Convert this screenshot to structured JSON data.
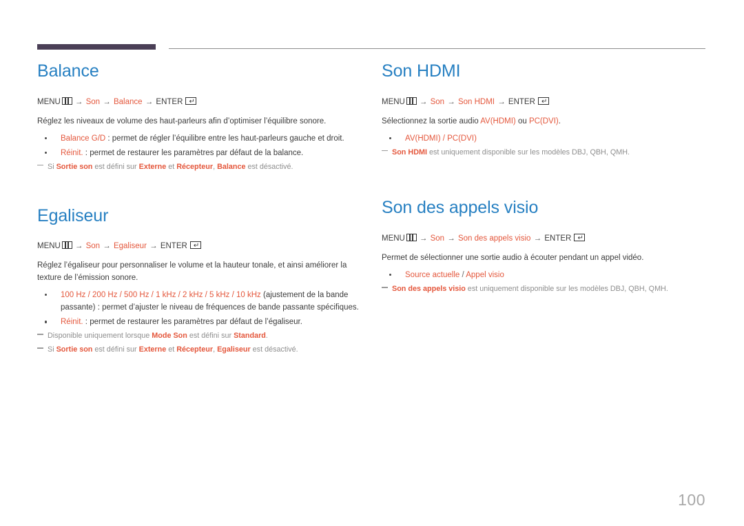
{
  "page": {
    "number": "100",
    "accent_blue": "#2780c2",
    "accent_orange": "#e4573c",
    "note_gray": "#8e8e8e",
    "header_bar_color": "#4a3f56"
  },
  "icons": {
    "menu": "menu-grid-icon",
    "enter": "enter-return-icon",
    "enter_glyph": "↵"
  },
  "labels": {
    "menu": "MENU",
    "enter": "ENTER",
    "arrow": "→"
  },
  "left_column": {
    "sections": [
      {
        "heading": "Balance",
        "menupath": {
          "menu": "MENU",
          "items": [
            "Son",
            "Balance"
          ],
          "enter": "ENTER"
        },
        "intro": "Réglez les niveaux de volume des haut-parleurs afin d’optimiser l’équilibre sonore.",
        "bullets": [
          {
            "kw": "Balance G/D",
            "rest": " : permet de régler l’équilibre entre les haut-parleurs gauche et droit."
          },
          {
            "kw": "Réinit.",
            "rest": " : permet de restaurer les paramètres par défaut de la balance."
          }
        ],
        "notes": [
          {
            "parts": [
              {
                "t": "Si ",
                "kw": false
              },
              {
                "t": "Sortie son",
                "kw": true
              },
              {
                "t": " est défini sur ",
                "kw": false
              },
              {
                "t": "Externe",
                "kw": true
              },
              {
                "t": " et ",
                "kw": false
              },
              {
                "t": "Récepteur",
                "kw": true
              },
              {
                "t": ", ",
                "kw": false
              },
              {
                "t": "Balance",
                "kw": true
              },
              {
                "t": " est désactivé.",
                "kw": false
              }
            ]
          }
        ]
      },
      {
        "heading": "Egaliseur",
        "menupath": {
          "menu": "MENU",
          "items": [
            "Son",
            "Egaliseur"
          ],
          "enter": "ENTER"
        },
        "intro": "Réglez l’égaliseur pour personnaliser le volume et la hauteur tonale, et ainsi améliorer la texture de l’émission sonore.",
        "bullets": [
          {
            "kw": "100 Hz / 200 Hz / 500 Hz / 1 kHz / 2 kHz / 5 kHz / 10 kHz",
            "rest": " (ajustement de la bande passante) : permet d’ajuster le niveau de fréquences de bande passante spécifiques."
          },
          {
            "kw": "Réinit.",
            "rest": " : permet de restaurer les paramètres par défaut de l’égaliseur."
          }
        ],
        "notes": [
          {
            "parts": [
              {
                "t": "Disponible uniquement lorsque ",
                "kw": false
              },
              {
                "t": "Mode Son",
                "kw": true
              },
              {
                "t": " est défini sur ",
                "kw": false
              },
              {
                "t": "Standard",
                "kw": true
              },
              {
                "t": ".",
                "kw": false
              }
            ]
          },
          {
            "parts": [
              {
                "t": "Si ",
                "kw": false
              },
              {
                "t": "Sortie son",
                "kw": true
              },
              {
                "t": " est défini sur ",
                "kw": false
              },
              {
                "t": "Externe",
                "kw": true
              },
              {
                "t": " et ",
                "kw": false
              },
              {
                "t": "Récepteur",
                "kw": true
              },
              {
                "t": ", ",
                "kw": false
              },
              {
                "t": "Egaliseur",
                "kw": true
              },
              {
                "t": " est désactivé.",
                "kw": false
              }
            ]
          }
        ]
      }
    ]
  },
  "right_column": {
    "sections": [
      {
        "heading": "Son HDMI",
        "menupath": {
          "menu": "MENU",
          "items": [
            "Son",
            "Son HDMI"
          ],
          "enter": "ENTER"
        },
        "intro_parts": [
          {
            "t": "Sélectionnez la sortie audio ",
            "kw": false
          },
          {
            "t": "AV(HDMI)",
            "kw": true
          },
          {
            "t": " ou ",
            "kw": false
          },
          {
            "t": "PC(DVI)",
            "kw": true
          },
          {
            "t": ".",
            "kw": false
          }
        ],
        "bullets": [
          {
            "kw": "AV(HDMI) / PC(DVI)",
            "rest": ""
          }
        ],
        "notes": [
          {
            "parts": [
              {
                "t": "Son HDMI",
                "kw": true
              },
              {
                "t": " est uniquement disponible sur les modèles DBJ, QBH, QMH.",
                "kw": false
              }
            ]
          }
        ]
      },
      {
        "heading": "Son des appels visio",
        "menupath": {
          "menu": "MENU",
          "items": [
            "Son",
            "Son des appels visio"
          ],
          "enter": "ENTER"
        },
        "intro": "Permet de sélectionner une sortie audio à écouter pendant un appel vidéo.",
        "bullets": [
          {
            "kw": "Source actuelle",
            "sep": " / ",
            "kw2": "Appel visio",
            "rest": ""
          }
        ],
        "notes": [
          {
            "parts": [
              {
                "t": "Son des appels visio",
                "kw": true
              },
              {
                "t": " est uniquement disponible sur les modèles DBJ, QBH, QMH.",
                "kw": false
              }
            ]
          }
        ]
      }
    ]
  }
}
